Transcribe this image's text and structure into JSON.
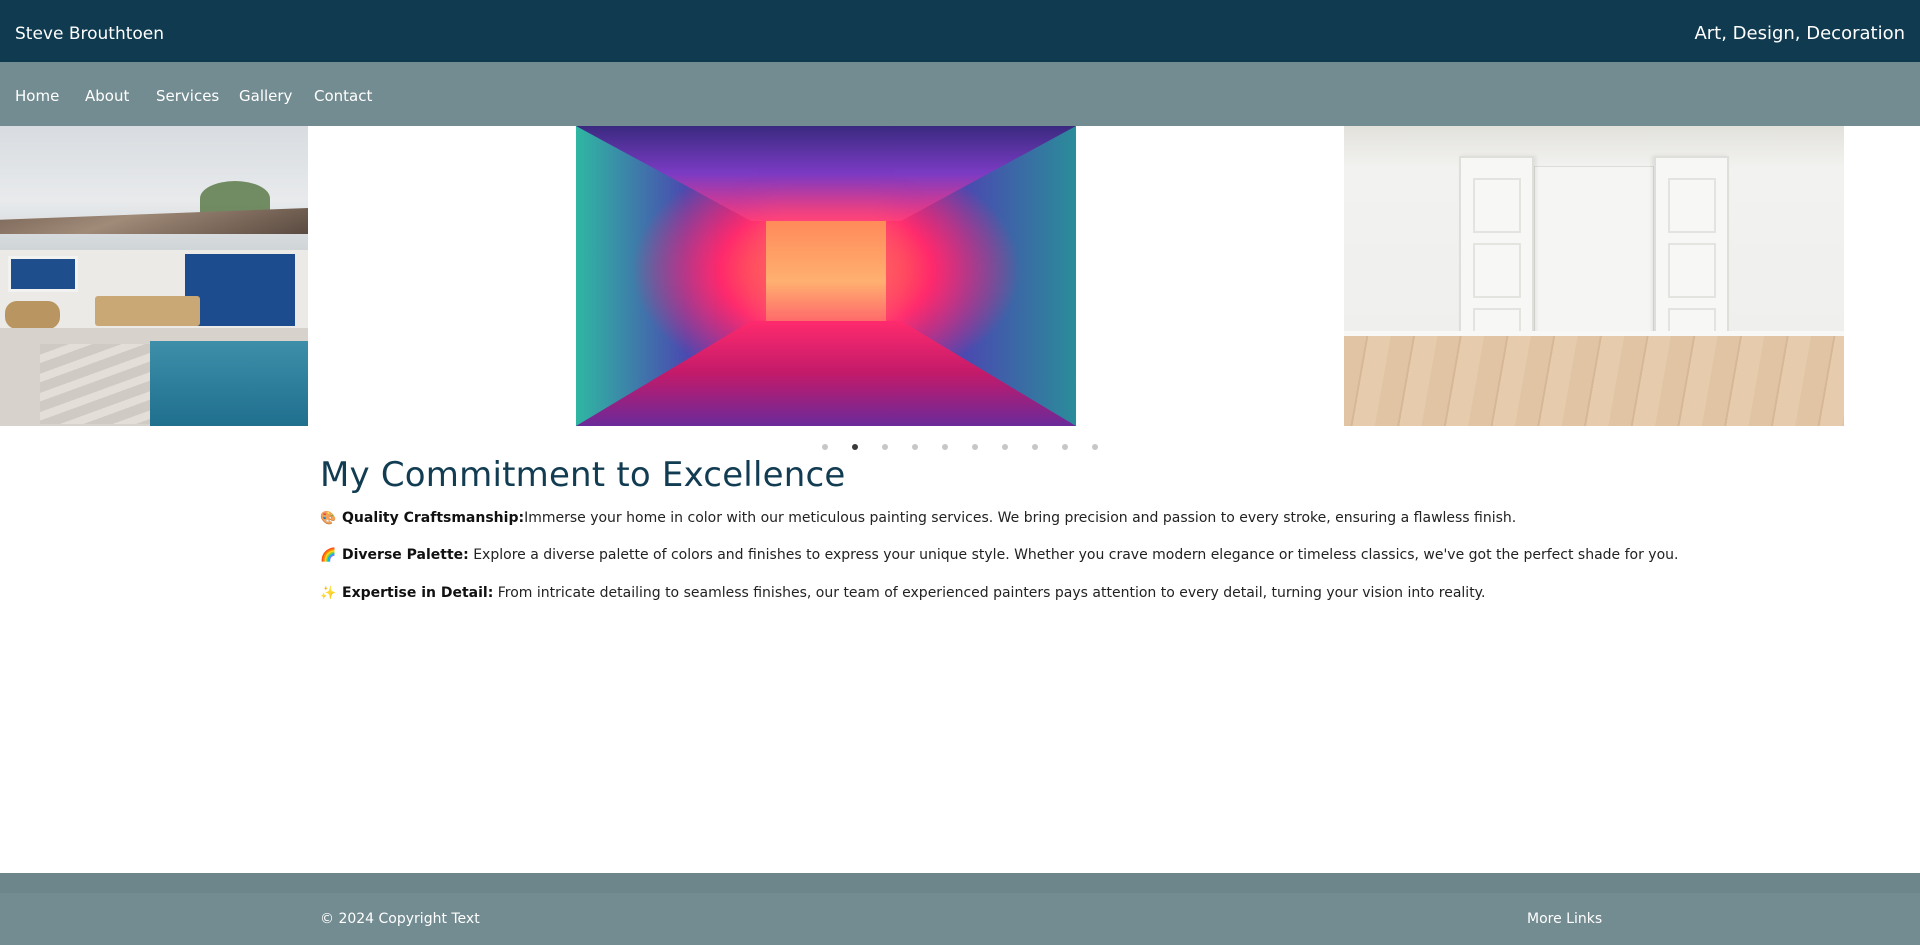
{
  "header": {
    "brand": "Steve Brouthtoen",
    "tagline": "Art, Design, Decoration"
  },
  "nav": {
    "items": [
      {
        "label": "Home"
      },
      {
        "label": "About"
      },
      {
        "label": "Services"
      },
      {
        "label": "Gallery"
      },
      {
        "label": "Contact"
      }
    ]
  },
  "carousel": {
    "slides": [
      {
        "subject": "poolside patio with blue doors"
      },
      {
        "subject": "neon lit corridor"
      },
      {
        "subject": "empty white room with open double doors"
      }
    ],
    "dot_count": 10,
    "active_index": 1
  },
  "main": {
    "heading": "My Commitment to Excellence",
    "features": [
      {
        "icon": "palette-icon",
        "emoji": "🎨",
        "title": "Quality Craftsmanship:",
        "text": "Immerse your home in color with our meticulous painting services. We bring precision and passion to every stroke, ensuring a flawless finish."
      },
      {
        "icon": "rainbow-icon",
        "emoji": "🌈",
        "title": "Diverse Palette:",
        "text": " Explore a diverse palette of colors and finishes to express your unique style. Whether you crave modern elegance or timeless classics, we've got the perfect shade for you."
      },
      {
        "icon": "sparkles-icon",
        "emoji": "✨",
        "title": "Expertise in Detail:",
        "text": " From intricate detailing to seamless finishes, our team of experienced painters pays attention to every detail, turning your vision into reality."
      }
    ]
  },
  "footer": {
    "copyright": "© 2024 Copyright Text",
    "more_links": "More Links"
  },
  "colors": {
    "topbar": "#0f3a4f",
    "navbar": "#738c91",
    "heading": "#123c52",
    "footer": "#738c91"
  }
}
